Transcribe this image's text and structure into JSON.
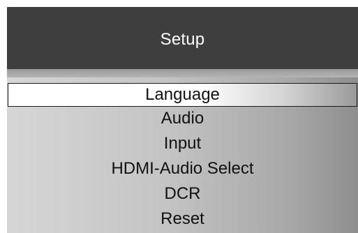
{
  "menu": {
    "title": "Setup",
    "items": [
      {
        "label": "Language",
        "selected": true
      },
      {
        "label": "Audio",
        "selected": false
      },
      {
        "label": "Input",
        "selected": false
      },
      {
        "label": "HDMI-Audio Select",
        "selected": false
      },
      {
        "label": "DCR",
        "selected": false
      },
      {
        "label": "Reset",
        "selected": false
      }
    ]
  }
}
